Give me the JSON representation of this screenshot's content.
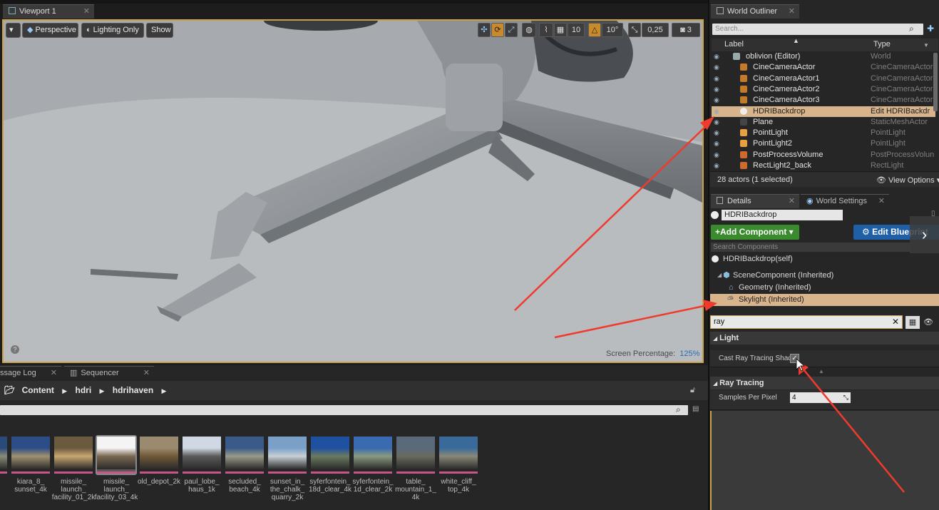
{
  "viewport": {
    "tab_label": "Viewport 1",
    "perspective": "Perspective",
    "lighting": "Lighting Only",
    "show": "Show",
    "grid_value": "10",
    "angle_value": "10°",
    "scale_value": "0,25",
    "cam_speed": "3",
    "screen_pct_label": "Screen Percentage:",
    "screen_pct_value": "125%"
  },
  "outliner": {
    "tab_label": "World Outliner",
    "search_placeholder": "Search...",
    "col_label": "Label",
    "col_type": "Type",
    "rows": [
      {
        "label": "oblivion (Editor)",
        "type": "World",
        "icon": "world-icon"
      },
      {
        "label": "CineCameraActor",
        "type": "CineCameraActor",
        "icon": "camera-icon"
      },
      {
        "label": "CineCameraActor1",
        "type": "CineCameraActor",
        "icon": "camera-icon"
      },
      {
        "label": "CineCameraActor2",
        "type": "CineCameraActor",
        "icon": "camera-icon"
      },
      {
        "label": "CineCameraActor3",
        "type": "CineCameraActor",
        "icon": "camera-icon"
      },
      {
        "label": "HDRIBackdrop",
        "type": "Edit HDRIBackdr",
        "icon": "sphere-icon"
      },
      {
        "label": "Plane",
        "type": "StaticMeshActor",
        "icon": "mesh-icon"
      },
      {
        "label": "PointLight",
        "type": "PointLight",
        "icon": "bulb-icon"
      },
      {
        "label": "PointLight2",
        "type": "PointLight",
        "icon": "bulb-icon"
      },
      {
        "label": "PostProcessVolume",
        "type": "PostProcessVolun",
        "icon": "volume-icon"
      },
      {
        "label": "RectLight2_back",
        "type": "RectLight",
        "icon": "rectlight-icon"
      }
    ],
    "status": "28 actors (1 selected)",
    "view_options": "View Options"
  },
  "details": {
    "tab_details": "Details",
    "tab_world_settings": "World Settings",
    "actor_name": "HDRIBackdrop",
    "add_component": "Add Component",
    "edit_blueprint": "Edit Blueprint",
    "search_components_placeholder": "Search Components",
    "components": {
      "self": "HDRIBackdrop(self)",
      "scene": "SceneComponent (Inherited)",
      "geometry": "Geometry (Inherited)",
      "skylight": "Skylight (Inherited)"
    },
    "search_value": "ray",
    "section_light": "Light",
    "cast_ray_label": "Cast Ray Tracing Shad",
    "cast_ray_checked": true,
    "section_ray_tracing": "Ray Tracing",
    "samples_label": "Samples Per Pixel",
    "samples_value": "4"
  },
  "bottom": {
    "tab_message_log": "ssage Log",
    "tab_sequencer": "Sequencer",
    "breadcrumb": [
      "Content",
      "hdri",
      "hdrihaven"
    ],
    "assets": [
      {
        "label": "",
        "colors": [
          "#2a4a7a",
          "#8a8a7a"
        ]
      },
      {
        "label": "kiara_8_\nsunset_4k",
        "colors": [
          "#2c4d86",
          "#a09070"
        ]
      },
      {
        "label": "missile_\nlaunch_\nfacility_01_2k",
        "colors": [
          "#6a5a40",
          "#c8a870"
        ]
      },
      {
        "label": "missile_\nlaunch_\nfacility_03_4k",
        "colors": [
          "#f4f4f4",
          "#7a6850"
        ]
      },
      {
        "label": "old_depot_2k",
        "colors": [
          "#9a8a70",
          "#705838"
        ]
      },
      {
        "label": "paul_lobe_\nhaus_1k",
        "colors": [
          "#cfd8e4",
          "#5a5a5a"
        ]
      },
      {
        "label": "secluded_\nbeach_4k",
        "colors": [
          "#3a5a8a",
          "#9a9a8a"
        ]
      },
      {
        "label": "sunset_in_\nthe_chalk_\nquarry_2k",
        "colors": [
          "#7aa0c8",
          "#c8d0d4"
        ]
      },
      {
        "label": "syferfontein_\n18d_clear_4k",
        "colors": [
          "#2050a0",
          "#6a7a60"
        ]
      },
      {
        "label": "syferfontein_\n1d_clear_2k",
        "colors": [
          "#3a6ab0",
          "#8a9a80"
        ]
      },
      {
        "label": "table_\nmountain_1_\n4k",
        "colors": [
          "#5a6a7a",
          "#6a6a60"
        ]
      },
      {
        "label": "white_cliff_\ntop_4k",
        "colors": [
          "#3a6a9a",
          "#8a8878"
        ]
      }
    ]
  }
}
